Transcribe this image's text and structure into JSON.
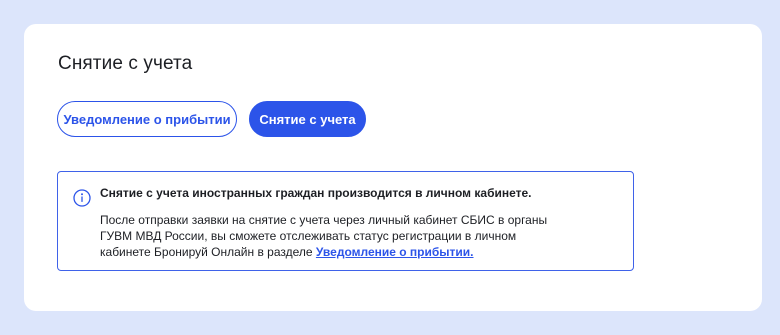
{
  "page": {
    "title": "Снятие с учета"
  },
  "tabs": [
    {
      "label": "Уведомление о прибытии",
      "active": false
    },
    {
      "label": "Снятие с учета",
      "active": true
    }
  ],
  "notice": {
    "icon": "info-icon",
    "heading": "Снятие с учета иностранных граждан производится в личном кабинете.",
    "line1": "После отправки заявки на снятие с учета через личный кабинет СБИС в органы",
    "line2": "ГУВМ МВД России, вы сможете отслеживать статус регистрации в личном",
    "line3": "кабинете Бронируй Онлайн в разделе ",
    "link": "Уведомление о прибытии."
  },
  "colors": {
    "background": "#dce5fb",
    "accent": "#2c54e9",
    "text": "#1d1f24"
  }
}
